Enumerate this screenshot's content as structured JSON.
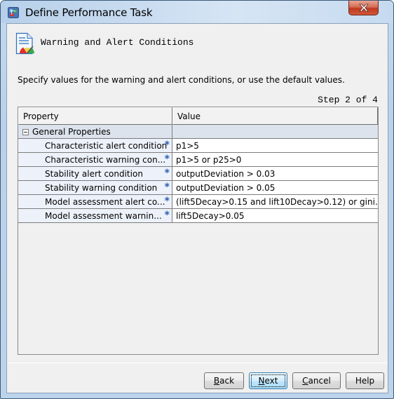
{
  "window": {
    "title": "Define Performance Task",
    "icons": {
      "app": "app-icon",
      "close": "close-icon"
    }
  },
  "header": {
    "title": "Warning and Alert Conditions",
    "icon": "report-gauge-icon"
  },
  "instruction": "Specify values for the warning and alert conditions, or use the default values.",
  "step": "Step 2 of 4",
  "table": {
    "columns": [
      "Property",
      "Value"
    ],
    "group": {
      "label": "General Properties",
      "expanded": true
    },
    "rows": [
      {
        "property": "Characteristic alert condition",
        "required_marker": "*",
        "value": "p1>5"
      },
      {
        "property": "Characteristic warning con...",
        "required_marker": "*",
        "value": "p1>5 or p25>0"
      },
      {
        "property": "Stability alert condition",
        "required_marker": "*",
        "value": "outputDeviation > 0.03"
      },
      {
        "property": "Stability warning condition",
        "required_marker": "*",
        "value": "outputDeviation > 0.05"
      },
      {
        "property": "Model assessment alert co...",
        "required_marker": "*",
        "value": "(lift5Decay>0.15 and lift10Decay>0.12) or gini..."
      },
      {
        "property": "Model assessment warnin...",
        "required_marker": "*",
        "value": "lift5Decay>0.05"
      }
    ]
  },
  "buttons": {
    "back": {
      "mnemonic": "B",
      "rest": "ack"
    },
    "next": {
      "mnemonic": "N",
      "rest": "ext"
    },
    "cancel": {
      "mnemonic": "C",
      "rest": "ancel"
    },
    "help": {
      "label": "Help"
    }
  },
  "colors": {
    "required_marker": "#2a5db0",
    "close_button": "#c7432a",
    "focused_button": "#bee6fd"
  }
}
